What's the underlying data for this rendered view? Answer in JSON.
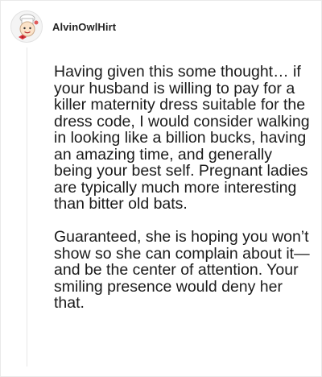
{
  "comment": {
    "author": {
      "username": "AlvinOwlHirt",
      "avatar_icon": "cartoon-chef-avatar-icon"
    },
    "paragraphs": [
      "Having given this some thought… if your husband is willing to pay for a killer maternity dress suitable for the dress code, I would consider walking in looking like a billion bucks, having an amazing time, and generally being your best self. Pregnant ladies are typically much more interesting than bitter old bats.",
      "Guaranteed, she is hoping you won’t show so she can complain about it—and be the center of attention. Your smiling presence would deny her that."
    ]
  },
  "colors": {
    "text": "#1a1a1a",
    "username": "#222222",
    "thread_line": "#e6e6e6",
    "border": "#e9e9e9"
  }
}
